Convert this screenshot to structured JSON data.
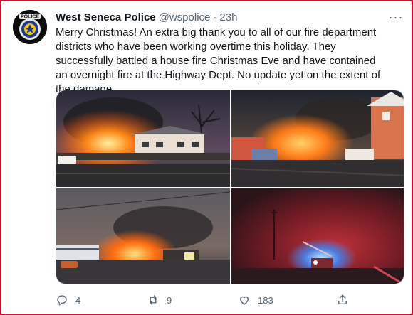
{
  "tweet": {
    "display_name": "West Seneca Police",
    "handle": "@wspolice",
    "separator": "·",
    "time": "23h",
    "more_label": "···",
    "text": "Merry Christmas! An extra big thank you to all of our fire department districts who have been working overtime this holiday. They successfully battled a house fire Christmas Eve and have contained an overnight fire at the Highway Dept. No update yet on the extent of the damage.",
    "avatar": {
      "badge_text": "POLICE",
      "badge_color": "#1d3a8a"
    }
  },
  "media": {
    "photos": [
      {
        "name": "house-fire-photo",
        "icon": "photo"
      },
      {
        "name": "street-fire-photo",
        "icon": "photo"
      },
      {
        "name": "highway-dept-fire-photo",
        "icon": "photo"
      },
      {
        "name": "fire-truck-night-photo",
        "icon": "photo"
      }
    ]
  },
  "actions": {
    "reply": {
      "icon": "reply-icon",
      "count": "4"
    },
    "retweet": {
      "icon": "retweet-icon",
      "count": "9"
    },
    "like": {
      "icon": "like-icon",
      "count": "183"
    },
    "share": {
      "icon": "share-icon"
    }
  },
  "colors": {
    "border": "#c8102e",
    "muted": "#536471",
    "text": "#0f1419"
  }
}
